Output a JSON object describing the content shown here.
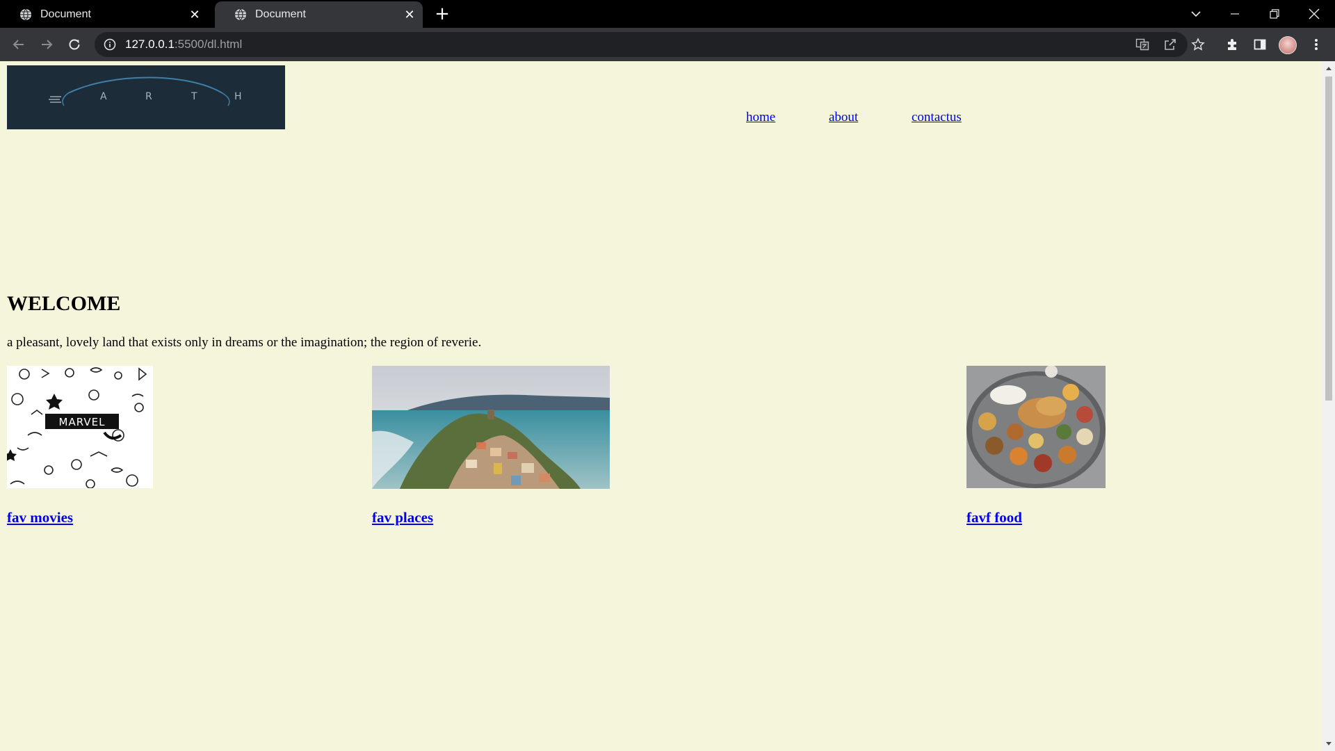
{
  "browser": {
    "tabs": [
      {
        "title": "Document",
        "active": false
      },
      {
        "title": "Document",
        "active": true
      }
    ],
    "url_host": "127.0.0.1",
    "url_rest": ":5500/dl.html"
  },
  "page": {
    "background": "#f5f5dc",
    "logo": {
      "letters": [
        "A",
        "R",
        "T",
        "H"
      ]
    },
    "nav": {
      "home": "home",
      "about": "about",
      "contact": "contactus"
    },
    "heading": "WELCOME",
    "tagline": "a pleasant, lovely land that exists only in dreams or the imagination; the region of reverie.",
    "cards": {
      "movies": {
        "label": "fav movies",
        "banner": "MARVEL"
      },
      "places": {
        "label": "fav places"
      },
      "food": {
        "label": "favf food"
      }
    }
  },
  "colors": {
    "link": "#0000ee",
    "logo_bg": "#1c2c38",
    "chrome_dark": "#35363a"
  }
}
